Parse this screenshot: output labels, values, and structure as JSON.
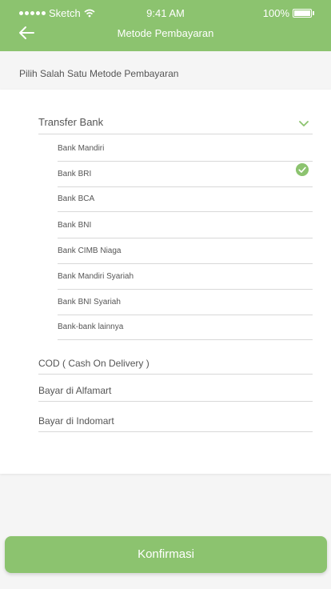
{
  "status_bar": {
    "carrier": "Sketch",
    "time": "9:41 AM",
    "battery": "100%"
  },
  "header": {
    "title": "Metode Pembayaran",
    "back_icon": "arrow-left-icon"
  },
  "subtitle": "Pilih Salah Satu Metode Pembayaran",
  "group": {
    "label": "Transfer Bank",
    "expanded": true,
    "banks": [
      {
        "label": "Bank Mandiri",
        "selected": false
      },
      {
        "label": "Bank BRI",
        "selected": true
      },
      {
        "label": "Bank BCA",
        "selected": false
      },
      {
        "label": "Bank BNI",
        "selected": false
      },
      {
        "label": "Bank CIMB Niaga",
        "selected": false
      },
      {
        "label": "Bank Mandiri Syariah",
        "selected": false
      },
      {
        "label": "Bank BNI Syariah",
        "selected": false
      },
      {
        "label": "Bank-bank lainnya",
        "selected": false
      }
    ]
  },
  "methods": [
    {
      "label": "COD ( Cash On Delivery )"
    },
    {
      "label": "Bayar di Alfamart"
    },
    {
      "label": "Bayar di Indomart"
    }
  ],
  "confirm_label": "Konfirmasi",
  "colors": {
    "accent": "#8cc36f",
    "background": "#f5f5f5",
    "text": "#555555",
    "divider": "#d8d8d8"
  }
}
